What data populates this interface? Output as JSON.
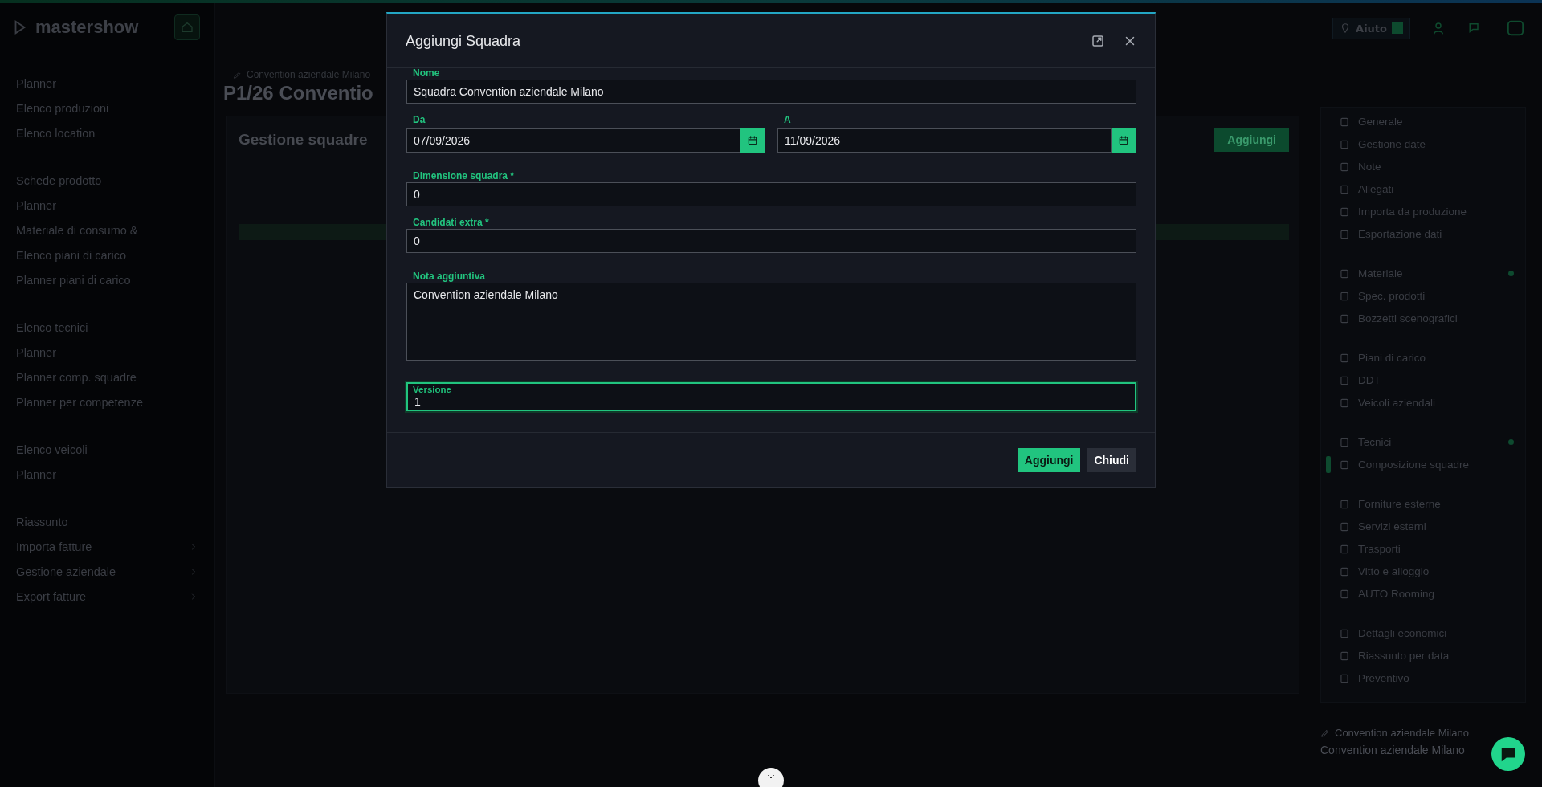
{
  "topbar": {
    "help_label": "Aiuto"
  },
  "sidebar": {
    "brand": "mastershow",
    "groups": [
      {
        "items": [
          {
            "label": "Planner",
            "expandable": false
          },
          {
            "label": "Elenco produzioni",
            "expandable": false
          },
          {
            "label": "Elenco location",
            "expandable": false
          }
        ]
      },
      {
        "items": [
          {
            "label": "Schede prodotto",
            "expandable": false
          },
          {
            "label": "Planner",
            "expandable": false
          },
          {
            "label": "Materiale di consumo &",
            "expandable": false
          },
          {
            "label": "Elenco piani di carico",
            "expandable": false
          },
          {
            "label": "Planner piani di carico",
            "expandable": false
          }
        ]
      },
      {
        "items": [
          {
            "label": "Elenco tecnici",
            "expandable": false
          },
          {
            "label": "Planner",
            "expandable": false
          },
          {
            "label": "Planner comp. squadre",
            "expandable": false
          },
          {
            "label": "Planner per competenze",
            "expandable": false
          }
        ]
      },
      {
        "items": [
          {
            "label": "Elenco veicoli",
            "expandable": false
          },
          {
            "label": "Planner",
            "expandable": false
          }
        ]
      },
      {
        "items": [
          {
            "label": "Riassunto",
            "expandable": false
          },
          {
            "label": "Importa fatture",
            "expandable": true
          },
          {
            "label": "Gestione aziendale",
            "expandable": true
          },
          {
            "label": "Export fatture",
            "expandable": true
          }
        ]
      }
    ]
  },
  "page": {
    "subtitle": "Convention aziendale Milano",
    "title": "P1/26 Conventio",
    "section_title": "Gestione squadre",
    "add_button": "Aggiungi"
  },
  "right_panel": {
    "groups": [
      {
        "items": [
          {
            "label": "Generale",
            "selected": false,
            "dot": false
          },
          {
            "label": "Gestione date",
            "selected": false,
            "dot": false
          },
          {
            "label": "Note",
            "selected": false,
            "dot": false
          },
          {
            "label": "Allegati",
            "selected": false,
            "dot": false
          },
          {
            "label": "Importa da produzione",
            "selected": false,
            "dot": false
          },
          {
            "label": "Esportazione dati",
            "selected": false,
            "dot": false
          }
        ]
      },
      {
        "items": [
          {
            "label": "Materiale",
            "selected": false,
            "dot": true
          },
          {
            "label": "Spec. prodotti",
            "selected": false,
            "dot": false
          },
          {
            "label": "Bozzetti scenografici",
            "selected": false,
            "dot": false
          }
        ]
      },
      {
        "items": [
          {
            "label": "Piani di carico",
            "selected": false,
            "dot": false
          },
          {
            "label": "DDT",
            "selected": false,
            "dot": false
          },
          {
            "label": "Veicoli aziendali",
            "selected": false,
            "dot": false
          }
        ]
      },
      {
        "items": [
          {
            "label": "Tecnici",
            "selected": false,
            "dot": true
          },
          {
            "label": "Composizione squadre",
            "selected": true,
            "dot": false
          }
        ]
      },
      {
        "items": [
          {
            "label": "Forniture esterne",
            "selected": false,
            "dot": false
          },
          {
            "label": "Servizi esterni",
            "selected": false,
            "dot": false
          },
          {
            "label": "Trasporti",
            "selected": false,
            "dot": false
          },
          {
            "label": "Vitto e alloggio",
            "selected": false,
            "dot": false
          },
          {
            "label": "AUTO Rooming",
            "selected": false,
            "dot": false
          }
        ]
      },
      {
        "items": [
          {
            "label": "Dettagli economici",
            "selected": false,
            "dot": false
          },
          {
            "label": "Riassunto per data",
            "selected": false,
            "dot": false
          },
          {
            "label": "Preventivo",
            "selected": false,
            "dot": false
          }
        ]
      }
    ],
    "footer_subtitle": "Convention aziendale Milano",
    "footer_title": "Convention aziendale Milano"
  },
  "dialog": {
    "title": "Aggiungi Squadra",
    "fields": [
      {
        "kind": "text",
        "label": "Nome",
        "value": "Squadra Convention aziendale Milano",
        "focused": false
      },
      {
        "kind": "date-range",
        "from": {
          "label": "Da",
          "value": "07/09/2026"
        },
        "to": {
          "label": "A",
          "value": "11/09/2026"
        }
      },
      {
        "kind": "text",
        "label": "Dimensione squadra *",
        "value": "0",
        "focused": false
      },
      {
        "kind": "text",
        "label": "Candidati extra *",
        "value": "0",
        "focused": false
      },
      {
        "kind": "textarea",
        "label": "Nota aggiuntiva",
        "value": "Convention aziendale Milano",
        "focused": false
      },
      {
        "kind": "text",
        "label": "Versione",
        "value": "1",
        "focused": true
      }
    ],
    "buttons": [
      {
        "label": "Aggiungi",
        "kind": "primary"
      },
      {
        "label": "Chiudi",
        "kind": "secondary"
      }
    ]
  }
}
